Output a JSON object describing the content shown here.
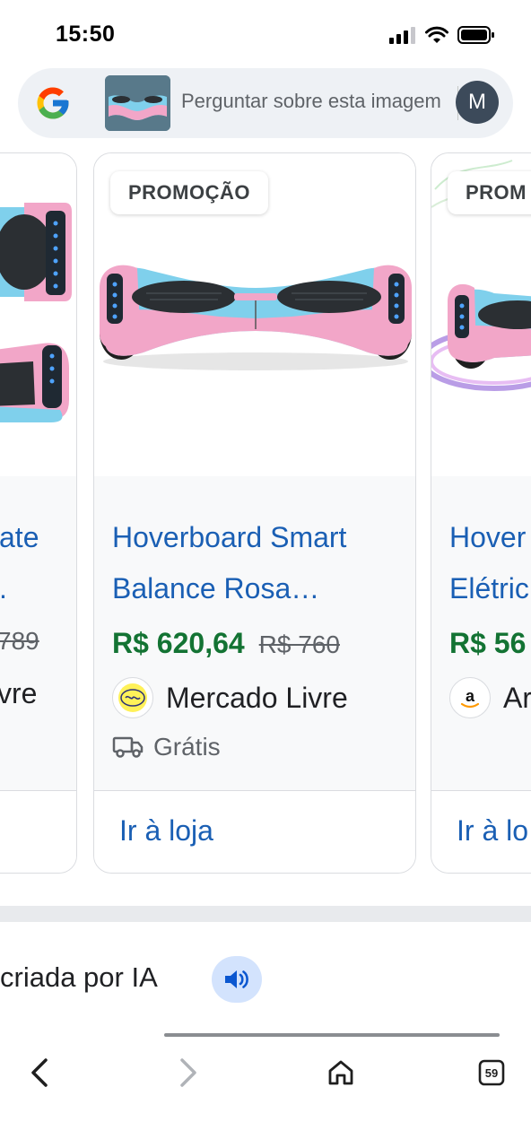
{
  "status_bar": {
    "time": "15:50"
  },
  "search": {
    "placeholder": "Perguntar sobre esta imagem",
    "avatar_letter": "M"
  },
  "products": [
    {
      "title_line1": "",
      "title_line2": "",
      "title_peek1": "ate",
      "title_peek2": ".",
      "price": "",
      "old_price": "789",
      "store": "vre",
      "link": ""
    },
    {
      "badge": "PROMOÇÃO",
      "title_line1": "Hoverboard Smart",
      "title_line2": "Balance Rosa…",
      "price": "R$ 620,64",
      "old_price": "R$ 760",
      "store": "Mercado Livre",
      "shipping": "Grátis",
      "link": "Ir à loja"
    },
    {
      "badge": "PROM",
      "title_line1": "Hover",
      "title_line2": "Elétric",
      "price": "R$ 56",
      "store": "Ar",
      "link": "Ir à lo"
    }
  ],
  "ai_note": {
    "text": "criada por IA"
  },
  "bottom_nav": {
    "tabs_count": "59"
  },
  "colors": {
    "link_blue": "#1a5fb4",
    "price_green": "#137333",
    "board_pink": "#f2a6c8",
    "board_blue": "#7fd0ec"
  },
  "icons": [
    "google-g-icon",
    "signal-icon",
    "wifi-icon",
    "battery-icon",
    "speaker-icon",
    "truck-icon",
    "back-icon",
    "forward-icon",
    "home-icon",
    "tabs-icon"
  ]
}
